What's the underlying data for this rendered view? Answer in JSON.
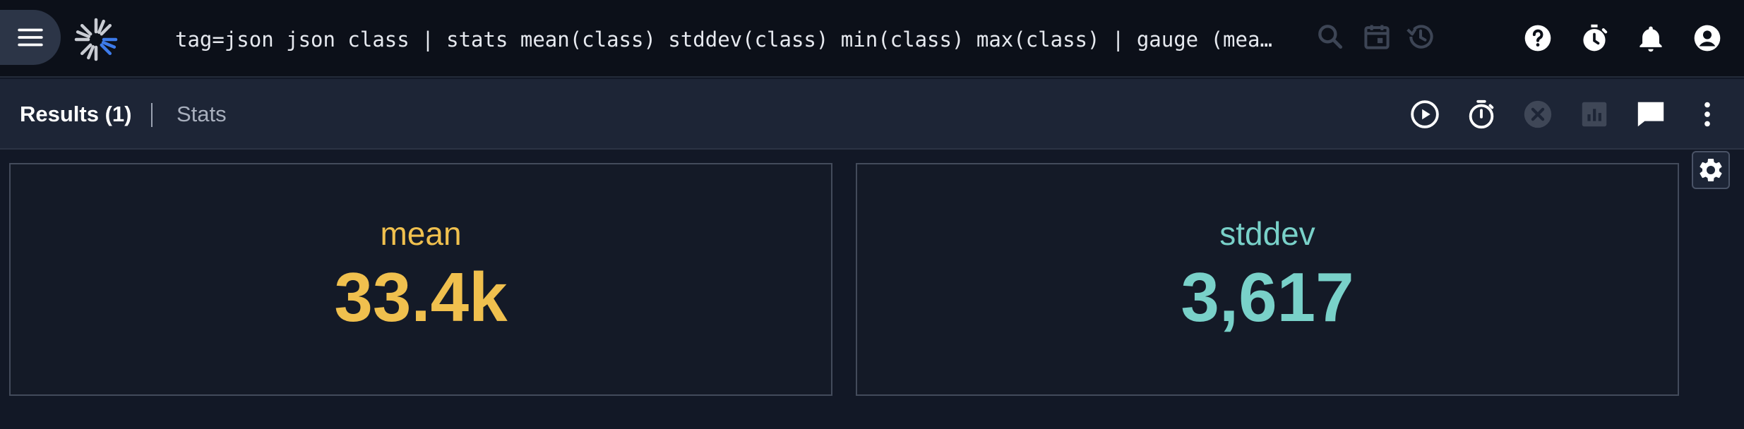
{
  "topbar": {
    "query": "tag=json json class | stats mean(class) stddev(class) min(class) max(class) | gauge (mean m…",
    "icons": [
      "menu-icon",
      "logo",
      "search-icon",
      "calendar-icon",
      "history-icon",
      "help-icon",
      "timer-icon",
      "bell-icon",
      "account-icon"
    ]
  },
  "subbar": {
    "tabs": [
      {
        "label": "Results (1)",
        "active": true
      },
      {
        "label": "Stats",
        "active": false
      }
    ],
    "icons": [
      "play-icon",
      "stopwatch-icon",
      "cancel-icon",
      "chart-icon",
      "comment-icon",
      "more-vert-icon"
    ]
  },
  "panels": [
    {
      "label": "mean",
      "value": "33.4k",
      "color": "#f0c04e"
    },
    {
      "label": "stddev",
      "value": "3,617",
      "color": "#79d1c9"
    }
  ],
  "colors": {
    "background": "#121826",
    "topbar": "#0c1019",
    "subbar": "#1d2536",
    "mean": "#f0c04e",
    "stddev": "#79d1c9"
  }
}
